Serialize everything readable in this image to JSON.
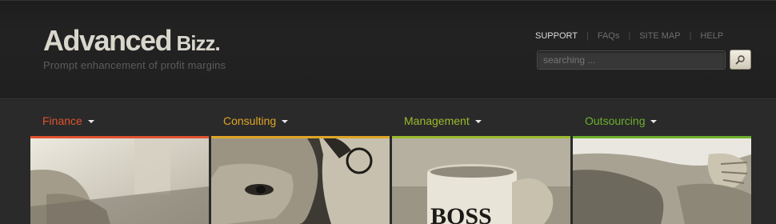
{
  "logo": {
    "main": "Advanced",
    "sub": "Bizz."
  },
  "tagline": "Prompt enhancement of profit margins",
  "topnav": {
    "items": [
      "SUPPORT",
      "FAQs",
      "SITE MAP",
      "HELP"
    ],
    "separator": "|"
  },
  "search": {
    "placeholder": "searching ...",
    "button_icon": "search-icon"
  },
  "categories": [
    {
      "label": "Finance",
      "color": "#e0522f"
    },
    {
      "label": "Consulting",
      "color": "#e0a526"
    },
    {
      "label": "Management",
      "color": "#9aba2d"
    },
    {
      "label": "Outsourcing",
      "color": "#6bb02d"
    }
  ],
  "mug_text": "BOSS"
}
